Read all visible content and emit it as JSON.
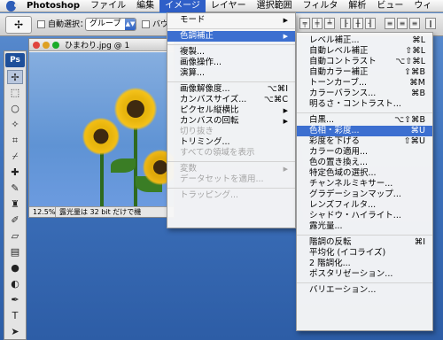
{
  "menubar": {
    "app": "Photoshop",
    "items": [
      "ファイル",
      "編集",
      "イメージ",
      "レイヤー",
      "選択範囲",
      "フィルタ",
      "解析",
      "ビュー",
      "ウィ"
    ],
    "active_index": 2
  },
  "options": {
    "auto_select_label": "自動選択：",
    "auto_select_value": "グループ",
    "bounds_label": "バウ"
  },
  "document": {
    "title": "ひまわり.jpg @ 1",
    "zoom": "12.5%",
    "status": "露光量は 32 bit だけで機"
  },
  "image_menu": {
    "items": [
      {
        "label": "モード",
        "submenu": true
      },
      {
        "sep": true
      },
      {
        "label": "色調補正",
        "submenu": true,
        "highlight": true
      },
      {
        "sep": true
      },
      {
        "label": "複製..."
      },
      {
        "label": "画像操作..."
      },
      {
        "label": "演算..."
      },
      {
        "sep": true
      },
      {
        "label": "画像解像度...",
        "shortcut": "⌥⌘I"
      },
      {
        "label": "カンバスサイズ...",
        "shortcut": "⌥⌘C"
      },
      {
        "label": "ピクセル縦横比",
        "submenu": true
      },
      {
        "label": "カンバスの回転",
        "submenu": true
      },
      {
        "label": "切り抜き",
        "disabled": true
      },
      {
        "label": "トリミング..."
      },
      {
        "label": "すべての領域を表示",
        "disabled": true
      },
      {
        "sep": true
      },
      {
        "label": "変数",
        "submenu": true,
        "disabled": true
      },
      {
        "label": "データセットを適用...",
        "disabled": true
      },
      {
        "sep": true
      },
      {
        "label": "トラッピング...",
        "disabled": true
      }
    ]
  },
  "adjust_menu": {
    "items": [
      {
        "label": "レベル補正...",
        "shortcut": "⌘L"
      },
      {
        "label": "自動レベル補正",
        "shortcut": "⇧⌘L"
      },
      {
        "label": "自動コントラスト",
        "shortcut": "⌥⇧⌘L"
      },
      {
        "label": "自動カラー補正",
        "shortcut": "⇧⌘B"
      },
      {
        "label": "トーンカーブ...",
        "shortcut": "⌘M"
      },
      {
        "label": "カラーバランス...",
        "shortcut": "⌘B"
      },
      {
        "label": "明るさ・コントラスト..."
      },
      {
        "sep": true
      },
      {
        "label": "白黒...",
        "shortcut": "⌥⇧⌘B"
      },
      {
        "label": "色相・彩度...",
        "shortcut": "⌘U",
        "highlight": true
      },
      {
        "label": "彩度を下げる",
        "shortcut": "⇧⌘U"
      },
      {
        "label": "カラーの適用..."
      },
      {
        "label": "色の置き換え..."
      },
      {
        "label": "特定色域の選択..."
      },
      {
        "label": "チャンネルミキサー..."
      },
      {
        "label": "グラデーションマップ..."
      },
      {
        "label": "レンズフィルタ..."
      },
      {
        "label": "シャドウ・ハイライト..."
      },
      {
        "label": "露光量..."
      },
      {
        "sep": true
      },
      {
        "label": "階調の反転",
        "shortcut": "⌘I"
      },
      {
        "label": "平均化 (イコライズ)"
      },
      {
        "label": "2 階調化..."
      },
      {
        "label": "ポスタリゼーション..."
      },
      {
        "sep": true
      },
      {
        "label": "バリエーション..."
      }
    ]
  },
  "colors": {
    "highlight": "#3c6fd0",
    "desktop": "#3f73bd"
  }
}
